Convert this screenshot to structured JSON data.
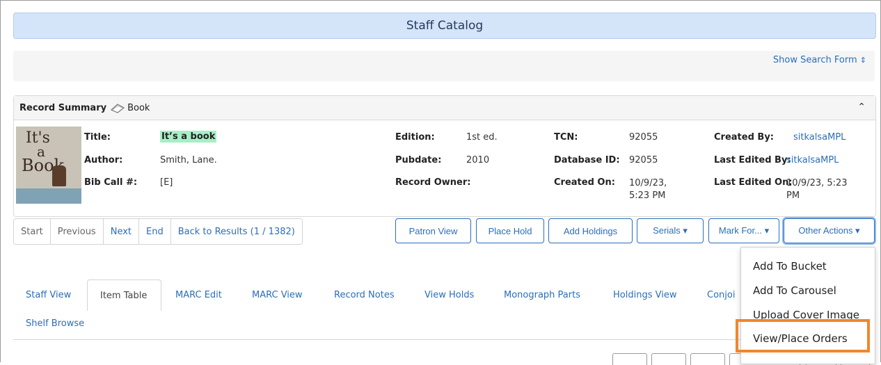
{
  "header": {
    "title": "Staff Catalog"
  },
  "search": {
    "show_label": "Show Search Form",
    "toggle_icon": "⌃⌄"
  },
  "summary": {
    "title": "Record Summary",
    "format": "Book",
    "collapse_icon": "^",
    "cover_text": [
      "It's",
      "a",
      "Book"
    ],
    "fields": {
      "title_label": "Title:",
      "title_value": "It’s a book",
      "author_label": "Author:",
      "author_value": "Smith, Lane.",
      "bib_label": "Bib Call #:",
      "bib_value": "[E]",
      "edition_label": "Edition:",
      "edition_value": "1st ed.",
      "pubdate_label": "Pubdate:",
      "pubdate_value": "2010",
      "owner_label": "Record Owner:",
      "owner_value": "",
      "tcn_label": "TCN:",
      "tcn_value": "92055",
      "dbid_label": "Database ID:",
      "dbid_value": "92055",
      "created_on_label": "Created On:",
      "created_on_value": "10/9/23, 5:23 PM",
      "created_by_label": "Created By:",
      "created_by_value": "sitkalsaMPL",
      "edited_by_label": "Last Edited By:",
      "edited_by_value": "sitkalsaMPL",
      "edited_on_label": "Last Edited On:",
      "edited_on_value": "10/9/23, 5:23 PM"
    }
  },
  "nav": {
    "start": "Start",
    "previous": "Previous",
    "next": "Next",
    "end": "End",
    "back": "Back to Results (1 / 1382)"
  },
  "actions": {
    "patron_view": "Patron View",
    "place_hold": "Place Hold",
    "add_holdings": "Add Holdings",
    "serials": "Serials ▾",
    "mark_for": "Mark For... ▾",
    "other_actions": "Other Actions ▾"
  },
  "dropdown": {
    "items": [
      "Add To Bucket",
      "Add To Carousel",
      "Upload Cover Image",
      "View/Place Orders"
    ],
    "highlighted": "View/Place Orders"
  },
  "tabs": {
    "items": [
      "Staff View",
      "Item Table",
      "MARC Edit",
      "MARC View",
      "Record Notes",
      "View Holds",
      "Monograph Parts",
      "Holdings View",
      "Conjoi"
    ],
    "active": "Item Table",
    "second_row": "Shelf Browse"
  },
  "colors": {
    "accent": "#2a6ebb",
    "title_bar": "#d4e4f9",
    "highlight": "#f0862e",
    "match": "#a5f0c6"
  }
}
